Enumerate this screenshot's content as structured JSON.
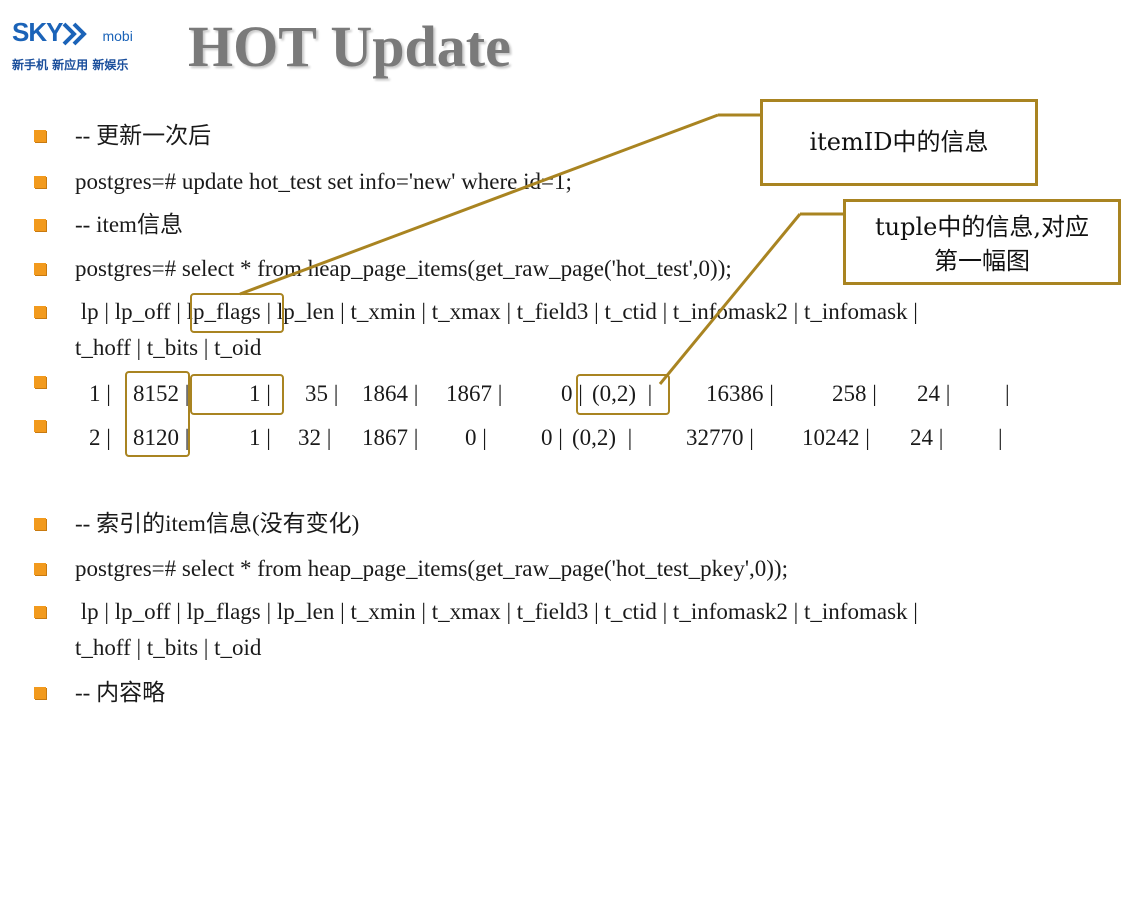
{
  "logo": {
    "brand": "SKY",
    "suffix": "mobi",
    "tagline": "新手机 新应用 新娱乐"
  },
  "title": "HOT Update",
  "bullets": [
    {
      "text": "-- 更新一次后"
    },
    {
      "text": "postgres=# update hot_test set info='new' where id=1;"
    },
    {
      "text": "-- item信息"
    },
    {
      "text": "postgres=# select * from heap_page_items(get_raw_page('hot_test',0));"
    },
    {
      "text": " lp | lp_off | lp_flags | lp_len | t_xmin | t_xmax | t_field3 | t_ctid | t_infomask2 | t_infomask |",
      "text2": "t_hoff | t_bits | t_oid"
    },
    {
      "cells": [
        "1 |",
        "8152 |",
        "1 |",
        "35 |",
        "1864 |",
        "1867 |",
        "0 |",
        "(0,2)  |",
        "16386 |",
        "258 |",
        "24 |",
        "|"
      ]
    },
    {
      "cells": [
        "2 |",
        "8120 |",
        "1 |",
        "32 |",
        "1867 |",
        "0 |",
        "0 |",
        "(0,2)  |",
        "32770 |",
        "10242 |",
        "24 |",
        "|"
      ]
    },
    {
      "text": "-- 索引的item信息(没有变化)"
    },
    {
      "text": "postgres=# select * from heap_page_items(get_raw_page('hot_test_pkey',0));"
    },
    {
      "text": " lp | lp_off | lp_flags | lp_len | t_xmin | t_xmax | t_field3 | t_ctid | t_infomask2 | t_infomask |",
      "text2": "t_hoff | t_bits | t_oid"
    },
    {
      "text": "-- 内容略"
    }
  ],
  "callouts": {
    "itemid": "itemID中的信息",
    "tuple_line1": "tuple中的信息,对应",
    "tuple_line2": "第一幅图"
  },
  "colors": {
    "bullet": "#f29a1d",
    "highlight": "#a98421",
    "title": "#7a7a7a",
    "logo": "#1b63b8"
  }
}
